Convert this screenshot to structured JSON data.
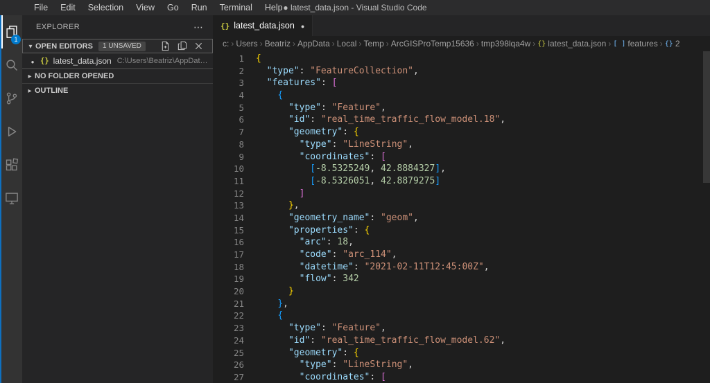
{
  "title_bar": {
    "menus": [
      "File",
      "Edit",
      "Selection",
      "View",
      "Go",
      "Run",
      "Terminal",
      "Help"
    ],
    "title": "● latest_data.json - Visual Studio Code"
  },
  "activity_bar": {
    "explorer_badge": "1"
  },
  "sidebar": {
    "title": "EXPLORER",
    "open_editors": {
      "label": "OPEN EDITORS",
      "badge": "1 UNSAVED",
      "items": [
        {
          "icon": "{}",
          "name": "latest_data.json",
          "path": "C:\\Users\\Beatriz\\AppData...",
          "modified": true
        }
      ]
    },
    "sections": [
      {
        "label": "NO FOLDER OPENED"
      },
      {
        "label": "OUTLINE"
      }
    ]
  },
  "editor": {
    "tab": {
      "icon": "{}",
      "label": "latest_data.json",
      "modified": true
    },
    "breadcrumbs": [
      {
        "label": "c:"
      },
      {
        "label": "Users"
      },
      {
        "label": "Beatriz"
      },
      {
        "label": "AppData"
      },
      {
        "label": "Local"
      },
      {
        "label": "Temp"
      },
      {
        "label": "ArcGISProTemp15636"
      },
      {
        "label": "tmp398lqa4w"
      },
      {
        "label": "latest_data.json",
        "icon": "{}",
        "icon_name": "json-file-icon",
        "icon_color": "#cbcb41"
      },
      {
        "label": "features",
        "icon": "[ ]",
        "icon_name": "symbol-array-icon",
        "icon_color": "#75beff"
      },
      {
        "label": "2",
        "icon": "{}",
        "icon_name": "symbol-object-icon",
        "icon_color": "#75beff"
      }
    ],
    "code": {
      "language": "json",
      "lines": [
        [
          [
            "b1",
            "{"
          ]
        ],
        [
          [
            "pl",
            "  "
          ],
          [
            "key",
            "\"type\""
          ],
          [
            "pl",
            ": "
          ],
          [
            "str",
            "\"FeatureCollection\""
          ],
          [
            "pl",
            ","
          ]
        ],
        [
          [
            "pl",
            "  "
          ],
          [
            "key",
            "\"features\""
          ],
          [
            "pl",
            ": "
          ],
          [
            "b2",
            "["
          ]
        ],
        [
          [
            "pl",
            "    "
          ],
          [
            "b3",
            "{"
          ]
        ],
        [
          [
            "pl",
            "      "
          ],
          [
            "key",
            "\"type\""
          ],
          [
            "pl",
            ": "
          ],
          [
            "str",
            "\"Feature\""
          ],
          [
            "pl",
            ","
          ]
        ],
        [
          [
            "pl",
            "      "
          ],
          [
            "key",
            "\"id\""
          ],
          [
            "pl",
            ": "
          ],
          [
            "str",
            "\"real_time_traffic_flow_model.18\""
          ],
          [
            "pl",
            ","
          ]
        ],
        [
          [
            "pl",
            "      "
          ],
          [
            "key",
            "\"geometry\""
          ],
          [
            "pl",
            ": "
          ],
          [
            "b1",
            "{"
          ]
        ],
        [
          [
            "pl",
            "        "
          ],
          [
            "key",
            "\"type\""
          ],
          [
            "pl",
            ": "
          ],
          [
            "str",
            "\"LineString\""
          ],
          [
            "pl",
            ","
          ]
        ],
        [
          [
            "pl",
            "        "
          ],
          [
            "key",
            "\"coordinates\""
          ],
          [
            "pl",
            ": "
          ],
          [
            "b2",
            "["
          ]
        ],
        [
          [
            "pl",
            "          "
          ],
          [
            "b3",
            "["
          ],
          [
            "num",
            "-8.5325249"
          ],
          [
            "pl",
            ", "
          ],
          [
            "num",
            "42.8884327"
          ],
          [
            "b3",
            "]"
          ],
          [
            "pl",
            ","
          ]
        ],
        [
          [
            "pl",
            "          "
          ],
          [
            "b3",
            "["
          ],
          [
            "num",
            "-8.5326051"
          ],
          [
            "pl",
            ", "
          ],
          [
            "num",
            "42.8879275"
          ],
          [
            "b3",
            "]"
          ]
        ],
        [
          [
            "pl",
            "        "
          ],
          [
            "b2",
            "]"
          ]
        ],
        [
          [
            "pl",
            "      "
          ],
          [
            "b1",
            "}"
          ],
          [
            "pl",
            ","
          ]
        ],
        [
          [
            "pl",
            "      "
          ],
          [
            "key",
            "\"geometry_name\""
          ],
          [
            "pl",
            ": "
          ],
          [
            "str",
            "\"geom\""
          ],
          [
            "pl",
            ","
          ]
        ],
        [
          [
            "pl",
            "      "
          ],
          [
            "key",
            "\"properties\""
          ],
          [
            "pl",
            ": "
          ],
          [
            "b1",
            "{"
          ]
        ],
        [
          [
            "pl",
            "        "
          ],
          [
            "key",
            "\"arc\""
          ],
          [
            "pl",
            ": "
          ],
          [
            "num",
            "18"
          ],
          [
            "pl",
            ","
          ]
        ],
        [
          [
            "pl",
            "        "
          ],
          [
            "key",
            "\"code\""
          ],
          [
            "pl",
            ": "
          ],
          [
            "str",
            "\"arc_114\""
          ],
          [
            "pl",
            ","
          ]
        ],
        [
          [
            "pl",
            "        "
          ],
          [
            "key",
            "\"datetime\""
          ],
          [
            "pl",
            ": "
          ],
          [
            "str",
            "\"2021-02-11T12:45:00Z\""
          ],
          [
            "pl",
            ","
          ]
        ],
        [
          [
            "pl",
            "        "
          ],
          [
            "key",
            "\"flow\""
          ],
          [
            "pl",
            ": "
          ],
          [
            "num",
            "342"
          ]
        ],
        [
          [
            "pl",
            "      "
          ],
          [
            "b1",
            "}"
          ]
        ],
        [
          [
            "pl",
            "    "
          ],
          [
            "b3",
            "}"
          ],
          [
            "pl",
            ","
          ]
        ],
        [
          [
            "pl",
            "    "
          ],
          [
            "b3",
            "{"
          ]
        ],
        [
          [
            "pl",
            "      "
          ],
          [
            "key",
            "\"type\""
          ],
          [
            "pl",
            ": "
          ],
          [
            "str",
            "\"Feature\""
          ],
          [
            "pl",
            ","
          ]
        ],
        [
          [
            "pl",
            "      "
          ],
          [
            "key",
            "\"id\""
          ],
          [
            "pl",
            ": "
          ],
          [
            "str",
            "\"real_time_traffic_flow_model.62\""
          ],
          [
            "pl",
            ","
          ]
        ],
        [
          [
            "pl",
            "      "
          ],
          [
            "key",
            "\"geometry\""
          ],
          [
            "pl",
            ": "
          ],
          [
            "b1",
            "{"
          ]
        ],
        [
          [
            "pl",
            "        "
          ],
          [
            "key",
            "\"type\""
          ],
          [
            "pl",
            ": "
          ],
          [
            "str",
            "\"LineString\""
          ],
          [
            "pl",
            ","
          ]
        ],
        [
          [
            "pl",
            "        "
          ],
          [
            "key",
            "\"coordinates\""
          ],
          [
            "pl",
            ": "
          ],
          [
            "b2",
            "["
          ]
        ]
      ]
    }
  },
  "colors": {
    "accent": "#007acc",
    "json_key": "#9cdcfe",
    "json_string": "#ce9178",
    "json_number": "#b5cea8",
    "bracket_level_1": "#ffd700",
    "bracket_level_2": "#da70d6",
    "bracket_level_3": "#179fff",
    "editor_background": "#1e1e1e",
    "sidebar_background": "#252526",
    "activity_bar_background": "#333333"
  }
}
